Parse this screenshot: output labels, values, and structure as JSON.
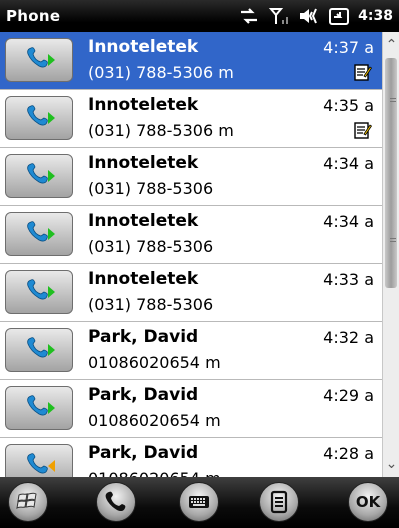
{
  "status_bar": {
    "title": "Phone",
    "time": "4:38"
  },
  "call_log": [
    {
      "name": "Innoteletek",
      "number": "(031) 788-5306 m",
      "time": "4:37 a",
      "selected": true,
      "has_note": true,
      "call_type": "outgoing"
    },
    {
      "name": "Innoteletek",
      "number": "(031) 788-5306 m",
      "time": "4:35 a",
      "selected": false,
      "has_note": true,
      "call_type": "outgoing"
    },
    {
      "name": "Innoteletek",
      "number": "(031) 788-5306",
      "time": "4:34 a",
      "selected": false,
      "has_note": false,
      "call_type": "outgoing"
    },
    {
      "name": "Innoteletek",
      "number": "(031) 788-5306",
      "time": "4:34 a",
      "selected": false,
      "has_note": false,
      "call_type": "outgoing"
    },
    {
      "name": "Innoteletek",
      "number": "(031) 788-5306",
      "time": "4:33 a",
      "selected": false,
      "has_note": false,
      "call_type": "outgoing"
    },
    {
      "name": "Park, David",
      "number": "01086020654 m",
      "time": "4:32 a",
      "selected": false,
      "has_note": false,
      "call_type": "outgoing"
    },
    {
      "name": "Park, David",
      "number": "01086020654 m",
      "time": "4:29 a",
      "selected": false,
      "has_note": false,
      "call_type": "outgoing"
    },
    {
      "name": "Park, David",
      "number": "01086020654 m",
      "time": "4:28 a",
      "selected": false,
      "has_note": false,
      "call_type": "incoming"
    }
  ],
  "bottom_bar": {
    "ok_label": "OK"
  },
  "colors": {
    "selection": "#3166c9",
    "call_arrow_green": "#1fbf1f",
    "call_arrow_orange": "#f0a000",
    "phone_icon": "#1f8ad2"
  }
}
